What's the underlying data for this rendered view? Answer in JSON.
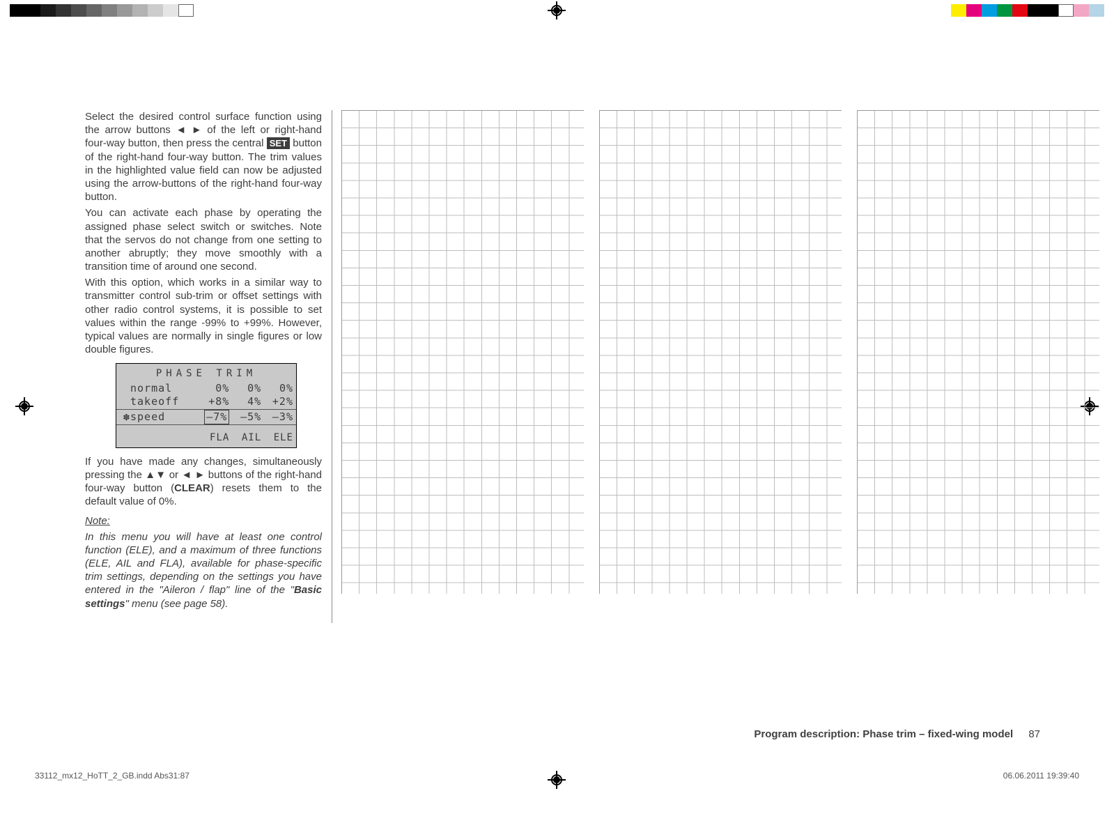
{
  "paragraphs": {
    "p1a": "Select the desired control surface function using the arrow buttons ◄ ► of the left or right-hand four-way button, then press the central ",
    "set": "SET",
    "p1b": " button of the right-hand four-way button. The trim values in the highlighted value field can now be adjusted using the arrow-buttons of the right-hand four-way button.",
    "p2": "You can activate each phase by operating the assigned phase select switch or switches. Note that the servos do not change from one setting to another abruptly; they move smoothly with a transition time of around one second.",
    "p3": "With this option, which works in a similar way to transmitter control sub-trim or offset settings with other radio control systems, it is possible to set values within the range -99% to +99%. However, typical values are normally in single figures or low double figures.",
    "p4a": "If you have made any changes, simultaneously pressing the ▲▼ or ◄ ► buttons of the right-hand four-way button (",
    "clear": "CLEAR",
    "p4b": ") resets them to the default value of 0%."
  },
  "note": {
    "heading": "Note:",
    "body_a": "In this menu you will have at least one control function (ELE), and a maximum of three functions (ELE, AIL and FLA), available for phase-specific trim settings, depending on the settings you have entered in the \"Aileron / flap\" line of the \"",
    "basic": "Basic settings",
    "body_b": "\" menu (see page 58)."
  },
  "lcd": {
    "title": "PHASE TRIM",
    "cols": [
      "FLA",
      "AIL",
      "ELE"
    ],
    "rows": {
      "r1_label": "normal",
      "r1_fla": "0%",
      "r1_ail": "0%",
      "r1_ele": "0%",
      "r2_label": "takeoff",
      "r2_fla": "+8%",
      "r2_ail": "4%",
      "r2_ele": "+2%",
      "r3_marker": "✽",
      "r3_label": "speed",
      "r3_fla": "–7%",
      "r3_ail": "–5%",
      "r3_ele": "–3%"
    }
  },
  "footer": {
    "section": "Program description: Phase trim – fixed-wing model",
    "page": "87",
    "file": "33112_mx12_HoTT_2_GB.indd   Abs31:87",
    "timestamp": "06.06.2011   19:39:40"
  }
}
